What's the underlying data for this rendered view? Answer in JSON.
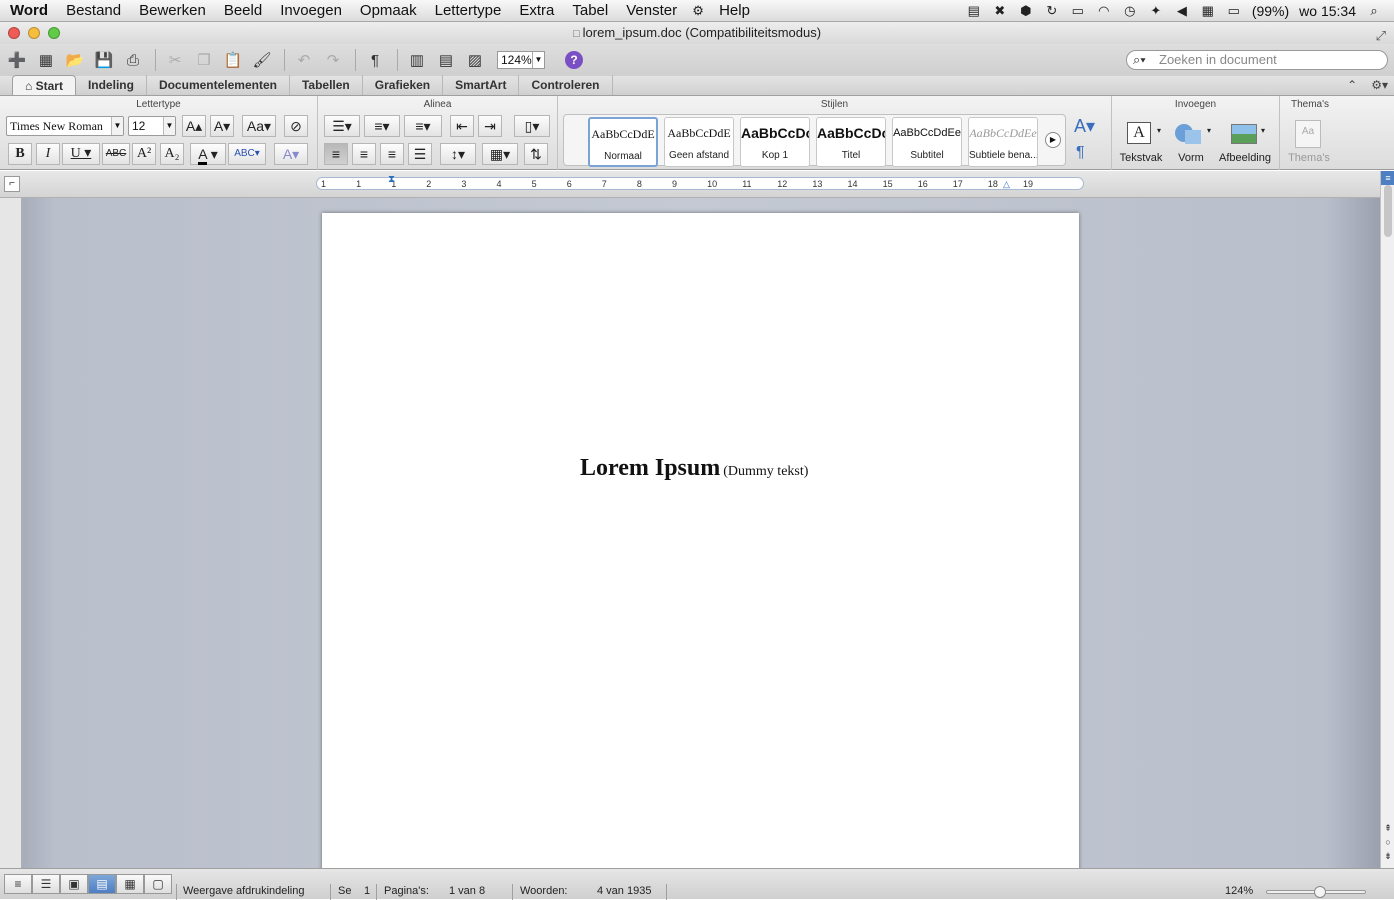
{
  "menubar": {
    "app": "Word",
    "items": [
      "Bestand",
      "Bewerken",
      "Beeld",
      "Invoegen",
      "Opmaak",
      "Lettertype",
      "Extra",
      "Tabel",
      "Venster",
      "Help"
    ],
    "battery": "(99%)",
    "clock": "wo 15:34"
  },
  "window": {
    "title": "lorem_ipsum.doc (Compatibiliteitsmodus)"
  },
  "toolbar": {
    "zoom": "124%",
    "help_label": "?",
    "search_placeholder": "Zoeken in document"
  },
  "tabs": [
    "Start",
    "Indeling",
    "Documentelementen",
    "Tabellen",
    "Grafieken",
    "SmartArt",
    "Controleren"
  ],
  "ribbon": {
    "groups": {
      "font": "Lettertype",
      "paragraph": "Alinea",
      "styles": "Stijlen",
      "insert": "Invoegen",
      "themes": "Thema's"
    },
    "font_name": "Times New Roman",
    "font_size": "12",
    "styles": [
      {
        "preview": "AaBbCcDdE",
        "name": "Normaal"
      },
      {
        "preview": "AaBbCcDdE",
        "name": "Geen afstand"
      },
      {
        "preview": "AaBbCcDc",
        "name": "Kop 1"
      },
      {
        "preview": "AaBbCcDc",
        "name": "Titel"
      },
      {
        "preview": "AaBbCcDdEe",
        "name": "Subtitel"
      },
      {
        "preview": "AaBbCcDdEe",
        "name": "Subtiele bena..."
      }
    ],
    "insert_buttons": {
      "textbox": "Tekstvak",
      "shape": "Vorm",
      "picture": "Afbeelding"
    },
    "themes_label": "Thema's"
  },
  "ruler": {
    "numbers": [
      "1",
      "1",
      "1",
      "2",
      "3",
      "4",
      "5",
      "6",
      "7",
      "8",
      "9",
      "10",
      "11",
      "12",
      "13",
      "14",
      "15",
      "16",
      "17",
      "18",
      "19"
    ]
  },
  "document": {
    "heading": "Lorem Ipsum",
    "subheading": "(Dummy tekst)"
  },
  "statusbar": {
    "view_name": "Weergave afdrukindeling",
    "section_label": "Se",
    "section_value": "1",
    "pages_label": "Pagina's:",
    "pages_value": "1 van 8",
    "words_label": "Woorden:",
    "words_value": "4 van 1935",
    "zoom": "124%"
  },
  "colors": {
    "accent": "#4d7fc2",
    "help": "#7a4fc4",
    "doc_background": "#c4c9d3"
  }
}
